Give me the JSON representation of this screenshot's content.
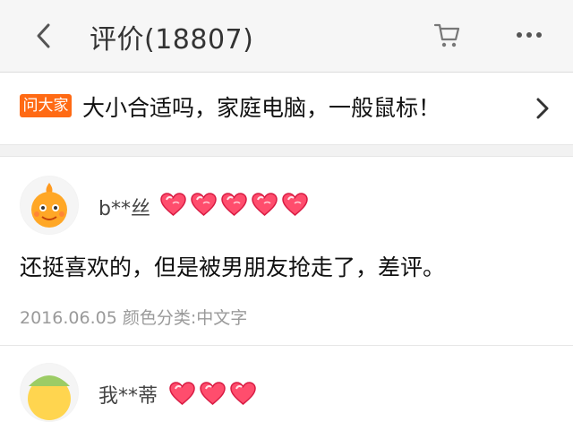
{
  "header": {
    "title": "评价(18807)",
    "icons": [
      "back-icon",
      "cart-icon",
      "more-icon"
    ]
  },
  "ask": {
    "badge": "问大家",
    "question": "大小合适吗，家庭电脑，一般鼠标！"
  },
  "reviews": [
    {
      "username": "b**丝",
      "hearts": 5,
      "content": "还挺喜欢的，但是被男朋友抢走了，差评。",
      "meta": "2016.06.05 颜色分类:中文字"
    },
    {
      "username": "我**蒂",
      "hearts": 3
    }
  ],
  "colors": {
    "accent": "#ff6a14",
    "heart": "#ff4d6d",
    "topbar_bg": "#f6f6f6"
  }
}
